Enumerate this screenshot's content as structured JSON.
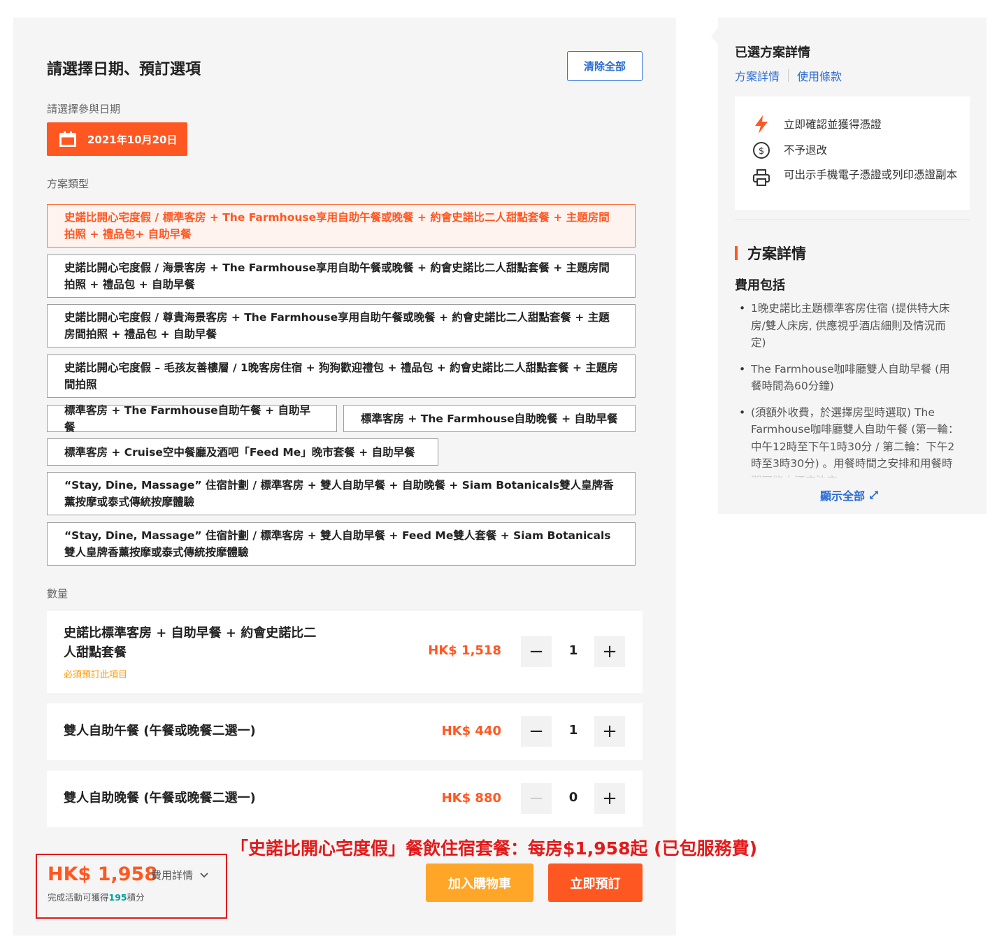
{
  "main": {
    "title": "請選擇日期、預訂選項",
    "clear_all": "清除全部",
    "date_label": "請選擇參與日期",
    "date_value": "2021年10月20日",
    "package_label": "方案類型",
    "packages": [
      "史諾比開心宅度假 / 標準客房 + The Farmhouse享用自助午餐或晚餐 + 約會史諾比二人甜點套餐 + 主題房間拍照 + 禮品包+ 自助早餐",
      "史諾比開心宅度假 / 海景客房 + The Farmhouse享用自助午餐或晚餐 + 約會史諾比二人甜點套餐 + 主題房間拍照 + 禮品包 + 自助早餐",
      "史諾比開心宅度假 / 尊貴海景客房 + The Farmhouse享用自助午餐或晚餐 + 約會史諾比二人甜點套餐 + 主題房間拍照 + 禮品包 + 自助早餐",
      "史諾比開心宅度假 – 毛孩友善樓層 / 1晚客房住宿 + 狗狗歡迎禮包 + 禮品包 + 約會史諾比二人甜點套餐 + 主題房間拍照",
      "標準客房 + The Farmhouse自助午餐 + 自助早餐",
      "標準客房 + The Farmhouse自助晚餐 + 自助早餐",
      "標準客房 + Cruise空中餐廳及酒吧「Feed Me」晚市套餐 + 自助早餐",
      "“Stay, Dine, Massage” 住宿計劃 / 標準客房 + 雙人自助早餐 + 自助晚餐 + Siam Botanicals雙人皇牌香薰按摩或泰式傳統按摩體驗",
      "“Stay, Dine, Massage” 住宿計劃 / 標準客房 + 雙人自助早餐 + Feed Me雙人套餐 + Siam Botanicals雙人皇牌香薰按摩或泰式傳統按摩體驗"
    ],
    "quantity_label": "數量",
    "quantities": [
      {
        "name": "史諾比標準客房 + 自助早餐 + 約會史諾比二人甜點套餐",
        "note": "必須預訂此項目",
        "price": "HK$ 1,518",
        "qty": "1",
        "minus_enabled": true
      },
      {
        "name": "雙人自助午餐 (午餐或晚餐二選一)",
        "price": "HK$ 440",
        "qty": "1",
        "minus_enabled": true
      },
      {
        "name": "雙人自助晚餐 (午餐或晚餐二選一)",
        "price": "HK$ 880",
        "qty": "0",
        "minus_enabled": false
      }
    ],
    "total": "HK$ 1,958",
    "fee_detail": "費用詳情",
    "points_prefix": "完成活動可獲得",
    "points_value": "195",
    "points_suffix": "積分",
    "add_to_cart": "加入購物車",
    "book_now": "立即預訂"
  },
  "promo_caption": "「史諾比開心宅度假」餐飲住宿套餐：每房$1,958起 (已包服務費)",
  "side": {
    "title": "已選方案詳情",
    "link_details": "方案詳情",
    "link_terms": "使用條款",
    "features": [
      {
        "icon": "lightning-icon",
        "text": "立即確認並獲得憑證"
      },
      {
        "icon": "no-refund-icon",
        "text": "不予退改"
      },
      {
        "icon": "printer-icon",
        "text": "可出示手機電子憑證或列印憑證副本"
      }
    ],
    "plan_heading": "方案詳情",
    "fee_includes": "費用包括",
    "includes": [
      "1晚史諾比主題標準客房住宿 (提供特大床房/雙人床房, 供應視乎酒店細則及情況而定)",
      "The Farmhouse咖啡廳雙人自助早餐 (用餐時間為60分鐘)",
      "(須額外收費，於選擇房型時選取) The Farmhouse咖啡廳雙人自助午餐 (第一輪：中午12時至下午1時30分 / 第二輪：下午2時至3時30分) 。用餐時間之安排和用餐時間可能由酒店決定"
    ],
    "show_all": "顯示全部"
  },
  "colors": {
    "accent": "#ff5722",
    "link": "#2b6cd4",
    "cart": "#ffa628",
    "points": "#00a19c",
    "promo": "#e21a1a"
  }
}
